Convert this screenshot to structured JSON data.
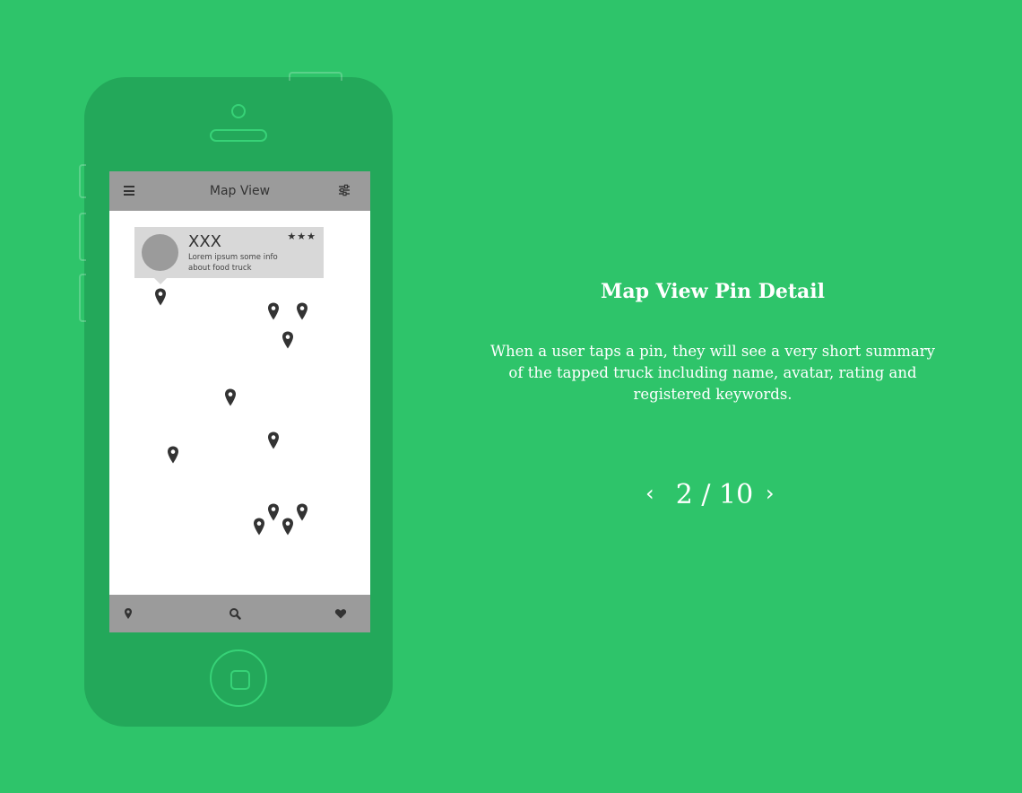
{
  "colors": {
    "background": "#2ec46a",
    "phone_body": "#23a85a",
    "phone_outline": "#37d277",
    "bar_gray": "#9b9b9b",
    "pin_dark": "#333333"
  },
  "phone": {
    "screen": {
      "topbar": {
        "title": "Map View",
        "menu_icon": "hamburger-icon",
        "filter_icon": "sliders-icon"
      },
      "popup": {
        "name": "XXX",
        "description": "Lorem ipsum some info about food truck",
        "stars": "★★★",
        "rating": 3
      },
      "pin_icon": "map-pin-icon",
      "bottombar": {
        "icons": [
          "map-pin-icon",
          "search-icon",
          "heart-icon"
        ]
      }
    }
  },
  "slide": {
    "title": "Map View Pin Detail",
    "description": "When a user taps a pin, they will see a very short summary of the tapped truck including name, avatar, rating and registered keywords.",
    "pager": {
      "prev": "‹",
      "count": "2 / 10",
      "next": "›",
      "current": 2,
      "total": 10
    }
  }
}
